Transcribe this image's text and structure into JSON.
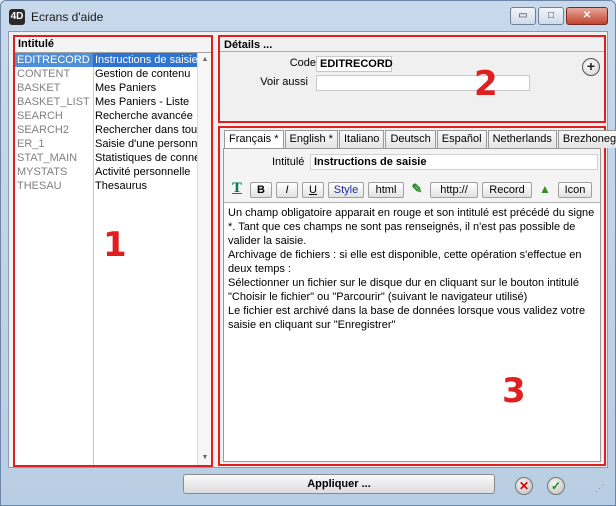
{
  "window": {
    "title": "Ecrans d'aide",
    "app_icon": "4D",
    "min_glyph": "▭",
    "max_glyph": "□",
    "close_glyph": "✕"
  },
  "list": {
    "header": "Intitulé",
    "rows": [
      {
        "code": "EDITRECORD",
        "title": "Instructions de saisie"
      },
      {
        "code": "CONTENT",
        "title": "Gestion de contenu"
      },
      {
        "code": "BASKET",
        "title": "Mes Paniers"
      },
      {
        "code": "BASKET_LIST",
        "title": "Mes Paniers - Liste"
      },
      {
        "code": "SEARCH",
        "title": "Recherche avancée"
      },
      {
        "code": "SEARCH2",
        "title": "Rechercher dans tout"
      },
      {
        "code": "ER_1",
        "title": "Saisie d'une personne"
      },
      {
        "code": "STAT_MAIN",
        "title": "Statistiques de connexion"
      },
      {
        "code": "MYSTATS",
        "title": "Activité personnelle"
      },
      {
        "code": "THESAU",
        "title": "Thesaurus"
      }
    ],
    "scroll_up": "▲",
    "scroll_down": "▼"
  },
  "details": {
    "title": "Détails ...",
    "code_label": "Code",
    "code_value": "EDITRECORD",
    "voir_label": "Voir aussi",
    "voir_value": "",
    "add_glyph": "+"
  },
  "tabs": [
    {
      "label": "Français *"
    },
    {
      "label": "English *"
    },
    {
      "label": "Italiano"
    },
    {
      "label": "Deutsch"
    },
    {
      "label": "Español"
    },
    {
      "label": "Netherlands"
    },
    {
      "label": "Brezhoneg"
    }
  ],
  "editor": {
    "intitule_label": "Intitulé",
    "intitule_value": "Instructions de saisie",
    "toolbar": {
      "t": "T",
      "b": "B",
      "i": "I",
      "u": "U",
      "style": "Style",
      "html": "html",
      "link": "✎",
      "http": "http://",
      "record": "Record",
      "image": "▲",
      "icon": "Icon"
    },
    "lines": [
      "Un champ obligatoire apparait en rouge et son intitulé est précédé du signe *. Tant que ces champs ne sont pas renseignés, il n'est pas possible de valider la saisie.",
      "Archivage de fichiers : si elle est disponible, cette opération s'effectue en deux temps :",
      "Sélectionner un fichier sur le disque dur en cliquant sur le bouton intitulé \"Choisir le fichier\" ou \"Parcourir\" (suivant le navigateur utilisé)",
      "Le fichier est archivé dans la base de données lorsque vous validez votre saisie en cliquant sur \"Enregistrer\""
    ]
  },
  "annotations": [
    "1",
    "2",
    "3"
  ],
  "footer": {
    "apply_label": "Appliquer ...",
    "cancel_glyph": "✕",
    "ok_glyph": "✓",
    "grip_glyph": "⋰"
  },
  "colors": {
    "highlight": "#e02020",
    "selection": "#2f73d0"
  }
}
